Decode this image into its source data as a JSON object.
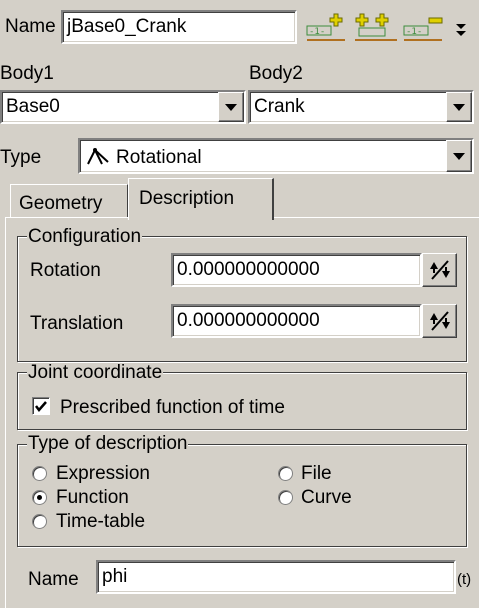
{
  "joint": {
    "name_label": "Name",
    "name_value": "jBase0_Crank",
    "body1_label": "Body1",
    "body1_value": "Base0",
    "body2_label": "Body2",
    "body2_value": "Crank",
    "type_label": "Type",
    "type_value": "Rotational",
    "toolbar_icons": [
      "add-icon",
      "add-multiple-icon",
      "remove-icon",
      "more-arrow-icon"
    ]
  },
  "tabs": [
    {
      "label": "Geometry",
      "active": false
    },
    {
      "label": "Description",
      "active": true
    }
  ],
  "configuration": {
    "title": "Configuration",
    "rotation_label": "Rotation",
    "rotation_value": "0.000000000000",
    "translation_label": "Translation",
    "translation_value": "0.000000000000"
  },
  "joint_coordinate": {
    "title": "Joint coordinate",
    "prescribed_label": "Prescribed function of time",
    "prescribed_checked": true
  },
  "description_type": {
    "title": "Type of description",
    "options": [
      "Expression",
      "File",
      "Function",
      "Curve",
      "Time-table"
    ],
    "selected": "Function"
  },
  "function": {
    "name_label": "Name",
    "name_value": "phi",
    "suffix": "(t)"
  },
  "colors": {
    "background": "#d4d0c8",
    "icon_green": "#3c8c3c",
    "icon_yellow": "#e0d000"
  }
}
